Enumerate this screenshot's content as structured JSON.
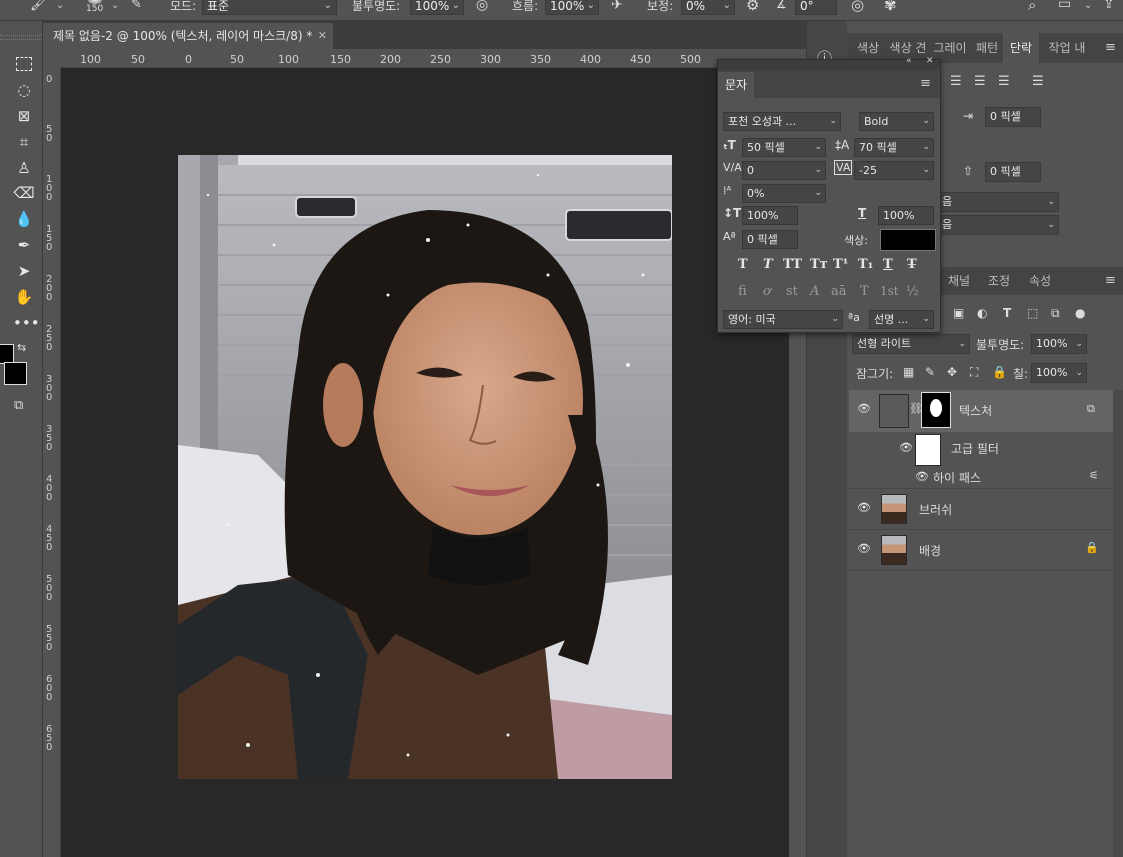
{
  "options_bar": {
    "brush_size": "150",
    "mode_label": "모드:",
    "mode_value": "표준",
    "opacity_label": "불투명도:",
    "opacity_value": "100%",
    "flow_label": "흐름:",
    "flow_value": "100%",
    "smoothing_label": "보정:",
    "smoothing_value": "0%",
    "angle_value": "0°"
  },
  "document": {
    "tab_title": "제목 없음-2 @ 100% (텍스처, 레이어 마스크/8) *",
    "ruler_h": [
      "100",
      "50",
      "0",
      "50",
      "100",
      "150",
      "200",
      "250",
      "300",
      "350",
      "400",
      "450",
      "500"
    ],
    "ruler_v": [
      "0",
      "5 0",
      "1 0 0",
      "1 5 0",
      "2 0 0",
      "2 5 0",
      "3 0 0",
      "3 5 0",
      "4 0 0",
      "4 5 0",
      "5 0 0",
      "5 5 0",
      "6 0 0",
      "6 5 0"
    ]
  },
  "right_tabs": [
    "색상",
    "색상 견",
    "그레이",
    "패턴",
    "단락",
    "작업 내"
  ],
  "paragraph": {
    "indent_left": "0 픽셀",
    "space_before": "0 픽셀",
    "dropdown1": "음",
    "dropdown2": "음"
  },
  "character_panel": {
    "title": "문자",
    "font_family": "포천 오성과 ...",
    "font_style": "Bold",
    "font_size": "50 픽셀",
    "leading": "70 픽셀",
    "kerning": "0",
    "tracking": "-25",
    "tsume": "0%",
    "vertical_scale": "100%",
    "horizontal_scale": "100%",
    "baseline_shift": "0 픽셀",
    "color_label": "색상:",
    "color_value": "#000000",
    "language": "영어: 미국",
    "aa_label": "ªa",
    "antialias": "선명 ...",
    "style_buttons": [
      "T",
      "T",
      "TT",
      "Tт",
      "T¹",
      "T₁",
      "T",
      "T̶"
    ],
    "opentype_buttons": [
      "fi",
      "ơ",
      "st",
      "A",
      "aā",
      "T",
      "1st",
      "½"
    ]
  },
  "layers_panel": {
    "tabs": [
      "채널",
      "조정",
      "속성"
    ],
    "blend_mode": "선형 라이트",
    "opacity_label": "불투명도:",
    "opacity_value": "100%",
    "lock_label": "잠그기:",
    "fill_label": "칠:",
    "fill_value": "100%",
    "layers": [
      {
        "name": "텍스처"
      },
      {
        "name": "고급 필터"
      },
      {
        "name": "하이 패스"
      },
      {
        "name": "브러쉬"
      },
      {
        "name": "배경"
      }
    ]
  },
  "colors": {
    "ui_bg": "#535353",
    "canvas_bg": "#282828",
    "panel_dark": "#3c3c3c",
    "field_bg": "#454545"
  }
}
